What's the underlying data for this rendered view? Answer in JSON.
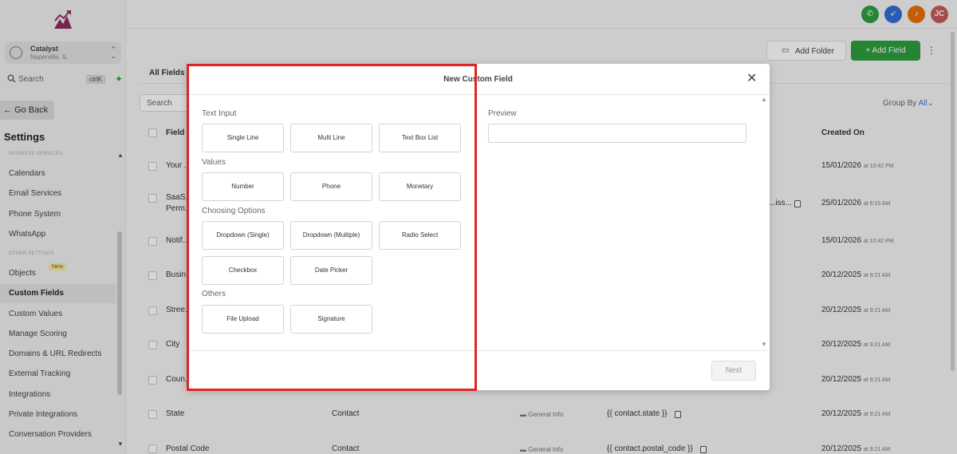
{
  "sidebar": {
    "account": {
      "name": "Catalyst",
      "location": "Naperville, IL"
    },
    "search": {
      "label": "Search",
      "shortcut": "ctrlK"
    },
    "go_back": "Go Back",
    "settings_title": "Settings",
    "section_headers": [
      "BUSINESS SERVICES",
      "OTHER SETTINGS"
    ],
    "items": [
      {
        "label": "Calendars"
      },
      {
        "label": "Email Services"
      },
      {
        "label": "Phone System"
      },
      {
        "label": "WhatsApp"
      },
      {
        "label": "Objects",
        "badge": "New"
      },
      {
        "label": "Custom Fields",
        "active": true
      },
      {
        "label": "Custom Values"
      },
      {
        "label": "Manage Scoring"
      },
      {
        "label": "Domains & URL Redirects"
      },
      {
        "label": "External Tracking"
      },
      {
        "label": "Integrations"
      },
      {
        "label": "Private Integrations"
      },
      {
        "label": "Conversation Providers"
      }
    ]
  },
  "topbar": {
    "user_initials": "JC",
    "icon_colors": {
      "phone": "#2e9e3e",
      "rocket": "#2f6fd6",
      "bell": "#e8710a",
      "avatar": "#c85a5a"
    }
  },
  "header": {
    "add_folder": "Add Folder",
    "add_field": "+ Add Field"
  },
  "tabs": {
    "all_fields": "All Fields"
  },
  "toolbar": {
    "search_placeholder": "Search",
    "group_by_label": "Group By",
    "group_by_value": "All"
  },
  "table": {
    "headers": {
      "field": "Field",
      "created_on": "Created On"
    },
    "rows": [
      {
        "name": "Your ...",
        "created": "15/01/2026",
        "time": "at 10:42 PM"
      },
      {
        "name": "SaaS...",
        "name2": "Perm...",
        "key": "...iss...",
        "created": "25/01/2026",
        "time": "at 6:15 AM"
      },
      {
        "name": "Notif...",
        "created": "15/01/2026",
        "time": "at 10:42 PM"
      },
      {
        "name": "Busin...",
        "created": "20/12/2025",
        "time": "at 9:21 AM"
      },
      {
        "name": "Stree...",
        "created": "20/12/2025",
        "time": "at 9:21 AM"
      },
      {
        "name": "City",
        "created": "20/12/2025",
        "time": "at 9:21 AM"
      },
      {
        "name": "Coun...",
        "created": "20/12/2025",
        "time": "at 9:21 AM"
      },
      {
        "name": "State",
        "object": "Contact",
        "folder": "General Info",
        "key": "{{ contact.state }}",
        "created": "20/12/2025",
        "time": "at 9:21 AM"
      },
      {
        "name": "Postal Code",
        "object": "Contact",
        "folder": "General Info",
        "key": "{{ contact.postal_code }}",
        "created": "20/12/2025",
        "time": "at 9:21 AM"
      }
    ]
  },
  "modal": {
    "title": "New Custom Field",
    "sections": {
      "text_input": {
        "label": "Text Input",
        "options": [
          "Single Line",
          "Multi Line",
          "Text Box List"
        ]
      },
      "values": {
        "label": "Values",
        "options": [
          "Number",
          "Phone",
          "Monetary"
        ]
      },
      "choosing_options": {
        "label": "Choosing Options",
        "options": [
          "Dropdown (Single)",
          "Dropdown (Multiple)",
          "Radio Select",
          "Checkbox",
          "Date Picker"
        ]
      },
      "others": {
        "label": "Others",
        "options": [
          "File Upload",
          "Signature"
        ]
      }
    },
    "preview_label": "Preview",
    "next_button": "Next"
  },
  "highlight_color": "#e02424"
}
